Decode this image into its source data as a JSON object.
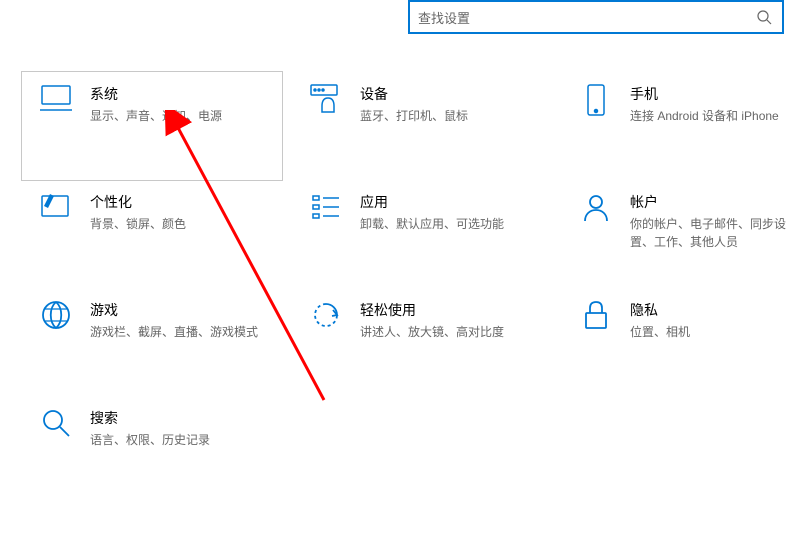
{
  "search": {
    "placeholder": "查找设置"
  },
  "categories": [
    {
      "key": "system",
      "title": "系统",
      "desc": "显示、声音、通知、电源",
      "hovered": true
    },
    {
      "key": "devices",
      "title": "设备",
      "desc": "蓝牙、打印机、鼠标",
      "hovered": false
    },
    {
      "key": "phone",
      "title": "手机",
      "desc": "连接 Android 设备和 iPhone",
      "hovered": false
    },
    {
      "key": "personalization",
      "title": "个性化",
      "desc": "背景、锁屏、颜色",
      "hovered": false
    },
    {
      "key": "apps",
      "title": "应用",
      "desc": "卸载、默认应用、可选功能",
      "hovered": false
    },
    {
      "key": "accounts",
      "title": "帐户",
      "desc": "你的帐户、电子邮件、同步设置、工作、其他人员",
      "hovered": false
    },
    {
      "key": "gaming",
      "title": "游戏",
      "desc": "游戏栏、截屏、直播、游戏模式",
      "hovered": false
    },
    {
      "key": "easeofaccess",
      "title": "轻松使用",
      "desc": "讲述人、放大镜、高对比度",
      "hovered": false
    },
    {
      "key": "privacy",
      "title": "隐私",
      "desc": "位置、相机",
      "hovered": false
    },
    {
      "key": "search",
      "title": "搜索",
      "desc": "语言、权限、历史记录",
      "hovered": false
    }
  ]
}
